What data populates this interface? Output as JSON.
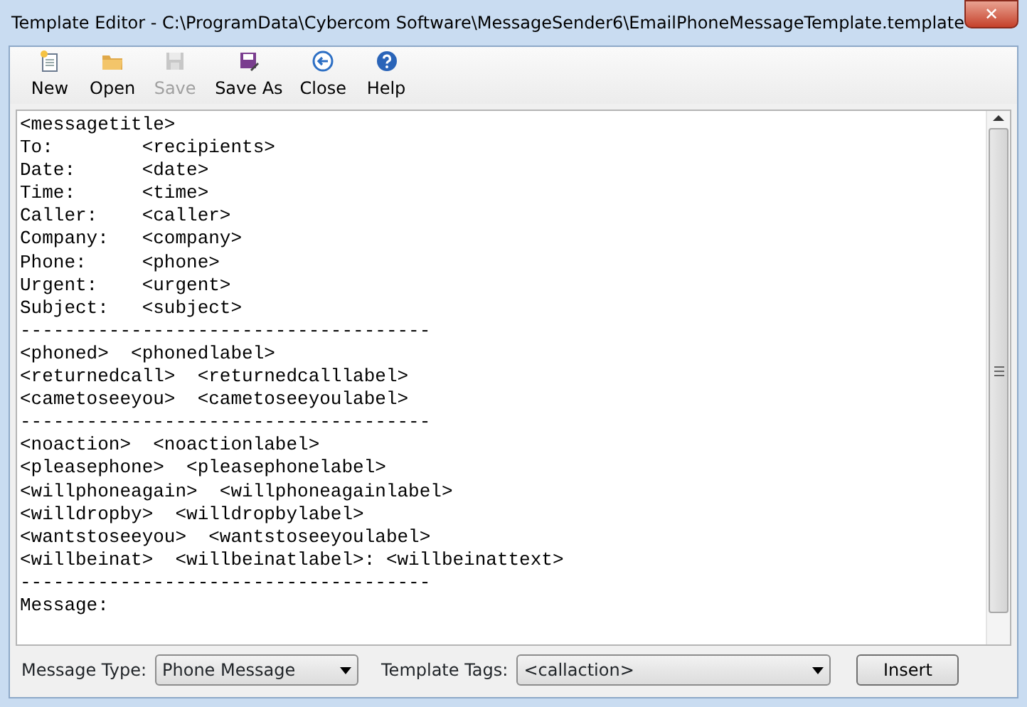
{
  "window": {
    "title": "Template Editor - C:\\ProgramData\\Cybercom Software\\MessageSender6\\EmailPhoneMessageTemplate.template",
    "close": "✕"
  },
  "toolbar": [
    {
      "label": "New",
      "kind": "new",
      "disabled": false
    },
    {
      "label": "Open",
      "kind": "open",
      "disabled": false
    },
    {
      "label": "Save",
      "kind": "save",
      "disabled": true
    },
    {
      "label": "Save As",
      "kind": "saveas",
      "disabled": false
    },
    {
      "label": "Close",
      "kind": "close",
      "disabled": false
    },
    {
      "label": "Help",
      "kind": "help",
      "disabled": false
    }
  ],
  "editor": {
    "lines": [
      "<messagetitle>",
      "To:        <recipients>",
      "Date:      <date>",
      "Time:      <time>",
      "Caller:    <caller>",
      "Company:   <company>",
      "Phone:     <phone>",
      "Urgent:    <urgent>",
      "Subject:   <subject>",
      "-------------------------------------",
      "<phoned>  <phonedlabel>",
      "<returnedcall>  <returnedcalllabel>",
      "<cametoseeyou>  <cametoseeyoulabel>",
      "-------------------------------------",
      "<noaction>  <noactionlabel>",
      "<pleasephone>  <pleasephonelabel>",
      "<willphoneagain>  <willphoneagainlabel>",
      "<willdropby>  <willdropbylabel>",
      "<wantstoseeyou>  <wantstoseeyoulabel>",
      "<willbeinat>  <willbeinatlabel>: <willbeinattext>",
      "-------------------------------------",
      "Message:"
    ]
  },
  "bottom": {
    "message_type": {
      "label": "Message Type:",
      "value": "Phone Message"
    },
    "template_tags": {
      "label": "Template Tags:",
      "value": "<callaction>"
    },
    "insert": "Insert"
  }
}
